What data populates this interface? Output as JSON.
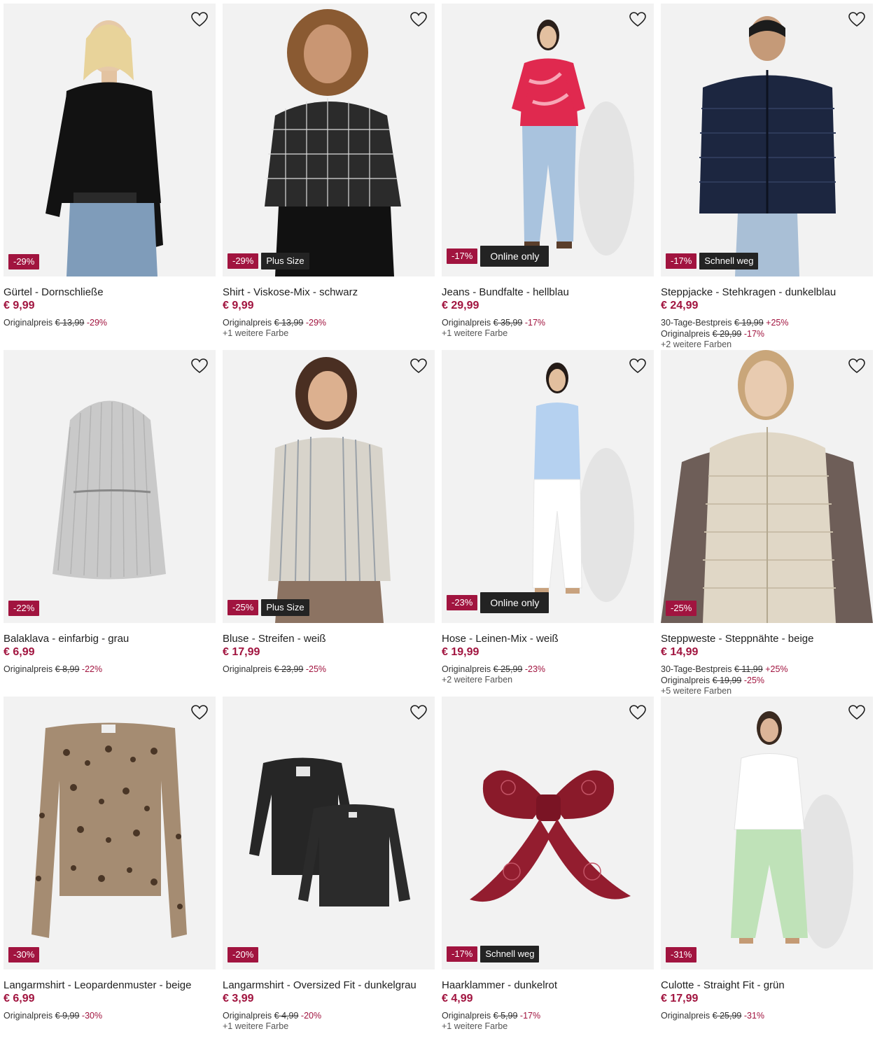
{
  "colors": {
    "accent": "#a1143f",
    "badge_dark": "#232323",
    "card_bg": "#f2f2f2"
  },
  "products": [
    {
      "title": "Gürtel - Dornschließe",
      "price": "€ 9,99",
      "discount_badge": "-29%",
      "tag": "",
      "best_label": "",
      "best_price": "",
      "best_pct": "",
      "orig_label": "Originalpreis",
      "orig_price": "€ 13,99",
      "orig_pct": "-29%",
      "more_colors": ""
    },
    {
      "title": "Shirt - Viskose-Mix - schwarz",
      "price": "€ 9,99",
      "discount_badge": "-29%",
      "tag": "Plus Size",
      "best_label": "",
      "best_price": "",
      "best_pct": "",
      "orig_label": "Originalpreis",
      "orig_price": "€ 13,99",
      "orig_pct": "-29%",
      "more_colors": "+1 weitere Farbe"
    },
    {
      "title": "Jeans - Bundfalte - hellblau",
      "price": "€ 29,99",
      "discount_badge": "-17%",
      "tag": "Online only",
      "best_label": "",
      "best_price": "",
      "best_pct": "",
      "orig_label": "Originalpreis",
      "orig_price": "€ 35,99",
      "orig_pct": "-17%",
      "more_colors": "+1 weitere Farbe"
    },
    {
      "title": "Steppjacke - Stehkragen - dunkelblau",
      "price": "€ 24,99",
      "discount_badge": "-17%",
      "tag": "Schnell weg",
      "best_label": "30-Tage-Bestpreis",
      "best_price": "€ 19,99",
      "best_pct": "+25%",
      "orig_label": "Originalpreis",
      "orig_price": "€ 29,99",
      "orig_pct": "-17%",
      "more_colors": "+2 weitere Farben"
    },
    {
      "title": "Balaklava - einfarbig - grau",
      "price": "€ 6,99",
      "discount_badge": "-22%",
      "tag": "",
      "best_label": "",
      "best_price": "",
      "best_pct": "",
      "orig_label": "Originalpreis",
      "orig_price": "€ 8,99",
      "orig_pct": "-22%",
      "more_colors": ""
    },
    {
      "title": "Bluse - Streifen - weiß",
      "price": "€ 17,99",
      "discount_badge": "-25%",
      "tag": "Plus Size",
      "best_label": "",
      "best_price": "",
      "best_pct": "",
      "orig_label": "Originalpreis",
      "orig_price": "€ 23,99",
      "orig_pct": "-25%",
      "more_colors": ""
    },
    {
      "title": "Hose - Leinen-Mix - weiß",
      "price": "€ 19,99",
      "discount_badge": "-23%",
      "tag": "Online only",
      "best_label": "",
      "best_price": "",
      "best_pct": "",
      "orig_label": "Originalpreis",
      "orig_price": "€ 25,99",
      "orig_pct": "-23%",
      "more_colors": "+2 weitere Farben"
    },
    {
      "title": "Steppweste - Steppnähte - beige",
      "price": "€ 14,99",
      "discount_badge": "-25%",
      "tag": "",
      "best_label": "30-Tage-Bestpreis",
      "best_price": "€ 11,99",
      "best_pct": "+25%",
      "orig_label": "Originalpreis",
      "orig_price": "€ 19,99",
      "orig_pct": "-25%",
      "more_colors": "+5 weitere Farben"
    },
    {
      "title": "Langarmshirt - Leopardenmuster - beige",
      "price": "€ 6,99",
      "discount_badge": "-30%",
      "tag": "",
      "best_label": "",
      "best_price": "",
      "best_pct": "",
      "orig_label": "Originalpreis",
      "orig_price": "€ 9,99",
      "orig_pct": "-30%",
      "more_colors": ""
    },
    {
      "title": "Langarmshirt - Oversized Fit - dunkelgrau",
      "price": "€ 3,99",
      "discount_badge": "-20%",
      "tag": "",
      "best_label": "",
      "best_price": "",
      "best_pct": "",
      "orig_label": "Originalpreis",
      "orig_price": "€ 4,99",
      "orig_pct": "-20%",
      "more_colors": "+1 weitere Farbe"
    },
    {
      "title": "Haarklammer - dunkelrot",
      "price": "€ 4,99",
      "discount_badge": "-17%",
      "tag": "Schnell weg",
      "best_label": "",
      "best_price": "",
      "best_pct": "",
      "orig_label": "Originalpreis",
      "orig_price": "€ 5,99",
      "orig_pct": "-17%",
      "more_colors": "+1 weitere Farbe"
    },
    {
      "title": "Culotte - Straight Fit - grün",
      "price": "€ 17,99",
      "discount_badge": "-31%",
      "tag": "",
      "best_label": "",
      "best_price": "",
      "best_pct": "",
      "orig_label": "Originalpreis",
      "orig_price": "€ 25,99",
      "orig_pct": "-31%",
      "more_colors": ""
    }
  ]
}
